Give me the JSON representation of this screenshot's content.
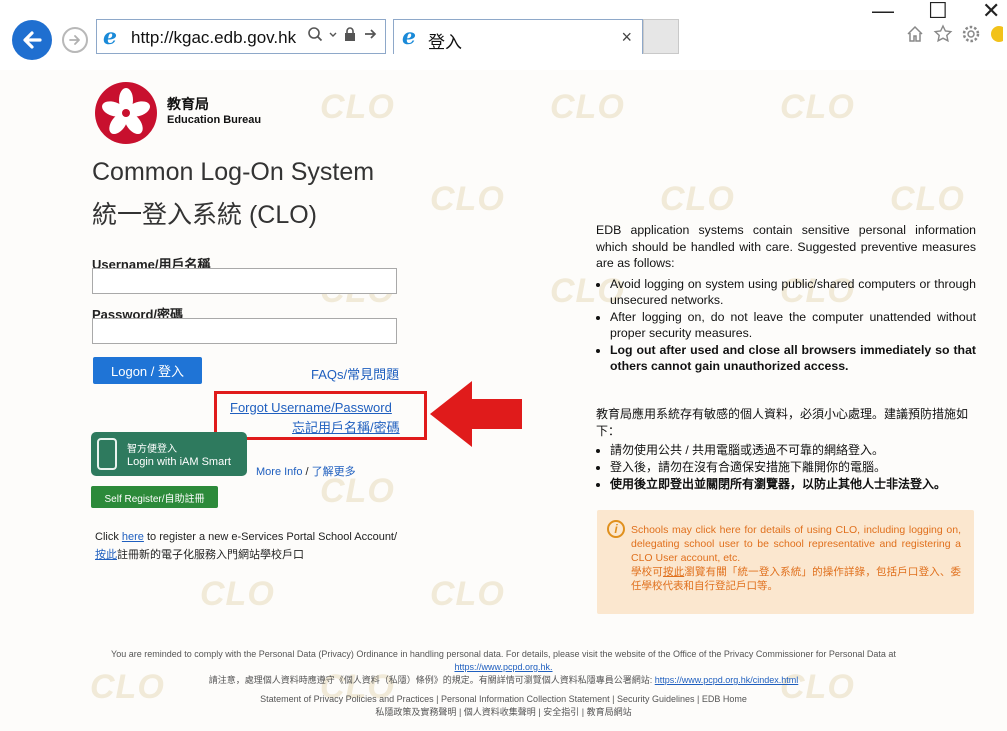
{
  "browser": {
    "url": "http://kgac.edb.gov.hk",
    "tab_title": "登入",
    "tab_close": "×",
    "window_controls": {
      "minimize": "—",
      "maximize": "☐",
      "close": "✕"
    },
    "icons": [
      "back-icon",
      "forward-icon",
      "ie-logo-icon",
      "search-icon",
      "dropdown-icon",
      "lock-icon",
      "refresh-icon",
      "home-icon",
      "favorites-star-icon",
      "settings-gear-icon",
      "smiley-icon"
    ]
  },
  "header": {
    "bureau_zh": "教育局",
    "bureau_en": "Education Bureau",
    "title_en": "Common Log-On System",
    "title_zh": "統一登入系統 (CLO)"
  },
  "watermark": "CLO",
  "login": {
    "username_label": "Username/用戶名稱",
    "username_value": "",
    "password_label": "Password/密碼",
    "password_value": "",
    "logon_button": "Logon / 登入",
    "faq_link": "FAQs/常見問題",
    "forgot_link_en": "Forgot Username/Password",
    "forgot_link_zh": "忘記用戶名稱/密碼",
    "iam_smart_line1": "智方便登入",
    "iam_smart_line2": "Login with iAM Smart",
    "more_info_en": "More Info",
    "more_info_sep": "/",
    "more_info_zh": "了解更多",
    "self_register_button": "Self Register/自助註冊",
    "register_prefix": "Click ",
    "register_link": "here",
    "register_suffix": " to register a new e-Services Portal School Account/",
    "register_zh_link": "按此",
    "register_zh_suffix": "註冊新的電子化服務入門網站學校戶口"
  },
  "notice": {
    "en_intro": "EDB application systems contain sensitive personal information which should be handled with care. Suggested preventive measures are as follows:",
    "en_items": [
      "Avoid logging on system using public/shared computers or through unsecured networks.",
      "After logging on, do not leave the computer unattended without proper security measures.",
      "Log out after used and close all browsers immediately so that others cannot gain unauthorized access."
    ],
    "zh_intro": "教育局應用系統存有敏感的個人資料，必須小心處理。建議預防措施如下：",
    "zh_items": [
      "請勿使用公共 / 共用電腦或透過不可靠的網絡登入。",
      "登入後，請勿在沒有合適保安措施下離開你的電腦。",
      "使用後立即登出並關閉所有瀏覽器，以防止其他人士非法登入。"
    ]
  },
  "info_box": {
    "icon": "info-icon",
    "en_prefix": "Schools may click ",
    "en_link": "here",
    "en_suffix": " for details of using CLO, including logging on, delegating school user to be school representative and registering a CLO User account, etc.",
    "zh_prefix": "學校可",
    "zh_link": "按此",
    "zh_suffix": "瀏覽有關「統一登入系統」的操作詳錄，包括戶口登入、委任學校代表和自行登記戶口等。"
  },
  "footer": {
    "line1": "You are reminded to comply with the Personal Data (Privacy) Ordinance in handling personal data. For details, please visit the website of the Office of the Privacy Commissioner for Personal Data at",
    "line1_link": "https://www.pcpd.org.hk.",
    "line2": "請注意，處理個人資料時應遵守《個人資料（私隱）條例》的規定。有關詳情可瀏覽個人資料私隱專員公署網站:",
    "line2_link": "https://www.pcpd.org.hk/cindex.html",
    "links_en": [
      "Statement of Privacy Policies and Practices",
      "Personal Information Collection Statement",
      "Security Guidelines",
      "EDB Home"
    ],
    "links_zh": [
      "私隱政策及實務聲明",
      "個人資料收集聲明",
      "安全指引",
      "教育局網站"
    ],
    "separator": "|"
  },
  "colors": {
    "accent_blue": "#1f74d6",
    "highlight_red": "#e01b1b",
    "iam_green": "#2e7a5e",
    "register_green": "#2c8a3a",
    "info_bg": "#fbe7cf",
    "info_text": "#e0701d"
  }
}
